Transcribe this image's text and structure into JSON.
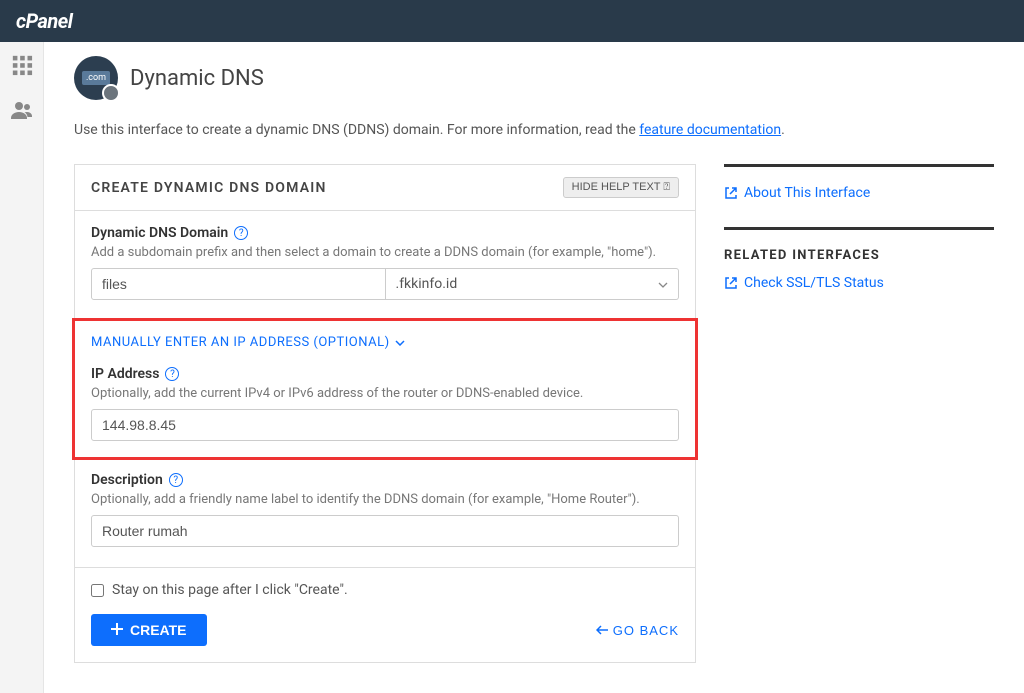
{
  "brand": "cPanel",
  "page": {
    "title": "Dynamic DNS",
    "intro_prefix": "Use this interface to create a dynamic DNS (DDNS) domain. For more information, read the ",
    "intro_link": "feature documentation",
    "intro_suffix": "."
  },
  "card": {
    "title": "CREATE DYNAMIC DNS DOMAIN",
    "help_button": "HIDE HELP TEXT"
  },
  "form": {
    "domain": {
      "label": "Dynamic DNS Domain",
      "hint": "Add a subdomain prefix and then select a domain to create a DDNS domain (for example, \"home\").",
      "prefix_value": "files",
      "select_value": ".fkkinfo.id"
    },
    "ip_section": {
      "toggle": "MANUALLY ENTER AN IP ADDRESS (OPTIONAL)",
      "label": "IP Address",
      "hint": "Optionally, add the current IPv4 or IPv6 address of the router or DDNS-enabled device.",
      "value": "144.98.8.45"
    },
    "description": {
      "label": "Description",
      "hint": "Optionally, add a friendly name label to identify the DDNS domain (for example, \"Home Router\").",
      "value": "Router rumah"
    },
    "stay_checkbox": "Stay on this page after I click \"Create\".",
    "create_button": "CREATE",
    "go_back": "GO BACK"
  },
  "side": {
    "about_link": "About This Interface",
    "related_heading": "RELATED INTERFACES",
    "related_link": "Check SSL/TLS Status"
  }
}
